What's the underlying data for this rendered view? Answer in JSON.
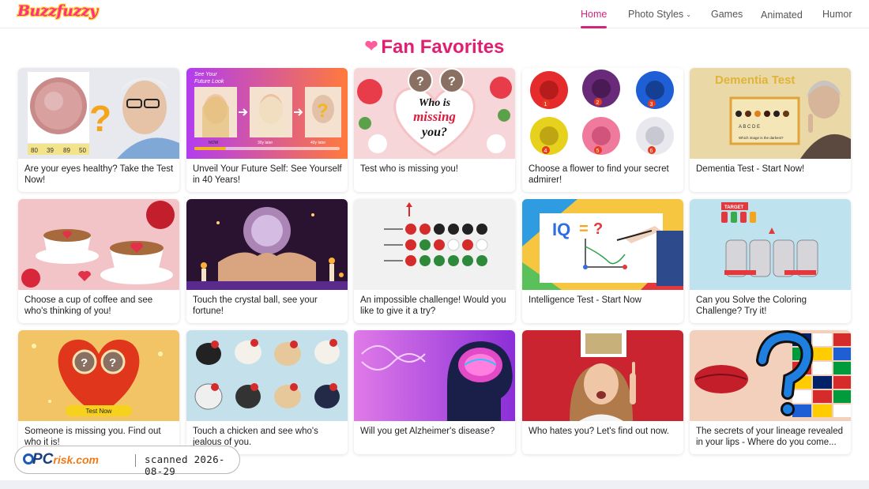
{
  "site": {
    "logo": "Buzzfuzzy"
  },
  "nav": {
    "home": "Home",
    "photo_styles": "Photo Styles",
    "games": "Games",
    "animated": "Animated",
    "humor": "Humor"
  },
  "section": {
    "title": "Fan Favorites"
  },
  "cards": [
    {
      "caption": "Are your eyes healthy? Take the Test Now!"
    },
    {
      "caption": "Unveil Your Future Self: See Yourself in 40 Years!"
    },
    {
      "caption": "Test who is missing you!"
    },
    {
      "caption": "Choose a flower to find your secret admirer!"
    },
    {
      "caption": "Dementia Test - Start Now!"
    },
    {
      "caption": "Choose a cup of coffee and see who's thinking of you!"
    },
    {
      "caption": "Touch the crystal ball, see your fortune!"
    },
    {
      "caption": "An impossible challenge! Would you like to give it a try?"
    },
    {
      "caption": "Intelligence Test - Start Now"
    },
    {
      "caption": "Can you Solve the Coloring Challenge? Try it!"
    },
    {
      "caption": "Someone is missing you. Find out who it is!"
    },
    {
      "caption": "Touch a chicken and see who's jealous of you."
    },
    {
      "caption": "Will you get Alzheimer's disease?"
    },
    {
      "caption": "Who hates you? Let's find out now."
    },
    {
      "caption": "The secrets of your lineage revealed in your lips - Where do you come..."
    }
  ],
  "thumb_text": {
    "eye_numbers": [
      "80",
      "39",
      "89",
      "50"
    ],
    "future_top": "See Your",
    "future_bottom": "Future Look",
    "future_now": "NOW",
    "future_30": "30y later",
    "future_40": "40y later",
    "missing_line1": "Who is",
    "missing_line2": "missing",
    "missing_line3": "you?",
    "flower_numbers": [
      "1",
      "2",
      "3",
      "4",
      "5",
      "6"
    ],
    "dementia_title": "Dementia Test",
    "dementia_letters": "A B C D E",
    "dementia_question": "Which image is the darkest?",
    "iq_label": "IQ",
    "iq_eq": "=",
    "iq_q": "?",
    "coloring_title": "TARGET",
    "heart_button": "Test Now",
    "heart_q1": "?",
    "heart_q2": "?"
  },
  "watermark": {
    "brand_pc": "PC",
    "brand_risk": "risk.com",
    "text": "scanned 2026-08-29"
  },
  "colors": {
    "accent": "#d4237a",
    "heading": "#e01f72"
  }
}
